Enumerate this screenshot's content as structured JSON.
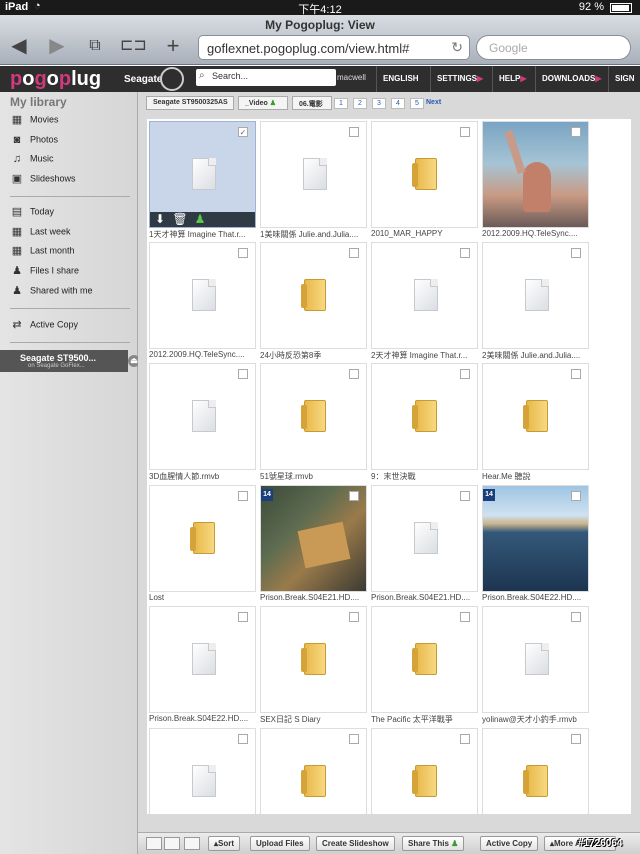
{
  "status": {
    "device": "iPad",
    "time": "下午4:12",
    "battery": "92 %"
  },
  "browser": {
    "title": "My Pogoplug: View",
    "url": "goflexnet.pogoplug.com/view.html#",
    "search_placeholder": "Google"
  },
  "topbar": {
    "brand": "Seagate",
    "search_placeholder": "Search...",
    "user": "macwell",
    "nav": [
      "ENGLISH",
      "SETTINGS",
      "HELP",
      "DOWNLOADS",
      "SIGN"
    ]
  },
  "sidebar": {
    "heading": "My library",
    "library": [
      "Movies",
      "Photos",
      "Music",
      "Slideshows"
    ],
    "recent": [
      "Today",
      "Last week",
      "Last month",
      "Files I share",
      "Shared with me"
    ],
    "active_copy": "Active Copy",
    "device_name": "Seagate ST9500...",
    "device_sub": "on Seagate GoFlex..."
  },
  "breadcrumb": [
    "Seagate ST9500325AS",
    "_Video",
    "06.電影"
  ],
  "pages": [
    "1",
    "2",
    "3",
    "4",
    "5"
  ],
  "next": "Next",
  "items": [
    {
      "label": "1天才神算 Imagine That.r...",
      "type": "file",
      "selected": true,
      "checked": "✓"
    },
    {
      "label": "1美味關係 Julie.and.Julia....",
      "type": "file"
    },
    {
      "label": "2010_MAR_HAPPY",
      "type": "folder"
    },
    {
      "label": "2012.2009.HQ.TeleSync....",
      "type": "photo-woman"
    },
    {
      "label": "2012.2009.HQ.TeleSync....",
      "type": "file"
    },
    {
      "label": "24小時反恐第8季",
      "type": "folder"
    },
    {
      "label": "2天才神算 Imagine That.r...",
      "type": "file"
    },
    {
      "label": "2美味關係 Julie.and.Julia....",
      "type": "file"
    },
    {
      "label": "3D血腥情人節.rmvb",
      "type": "file"
    },
    {
      "label": "51號星球.rmvb",
      "type": "folder"
    },
    {
      "label": "9：末世決戰",
      "type": "folder"
    },
    {
      "label": "Hear.Me 聽說",
      "type": "folder"
    },
    {
      "label": "Lost",
      "type": "folder"
    },
    {
      "label": "Prison.Break.S04E21.HD....",
      "type": "photo-hands",
      "badge": "14"
    },
    {
      "label": "Prison.Break.S04E21.HD....",
      "type": "file"
    },
    {
      "label": "Prison.Break.S04E22.HD....",
      "type": "photo-city",
      "badge": "14"
    },
    {
      "label": "Prison.Break.S04E22.HD....",
      "type": "file"
    },
    {
      "label": "SEX日記 S Diary",
      "type": "folder"
    },
    {
      "label": "The Pacific 太平洋戰爭",
      "type": "folder"
    },
    {
      "label": "yolinaw@天才小釣手.rmvb",
      "type": "file"
    },
    {
      "label": "",
      "type": "file"
    },
    {
      "label": "",
      "type": "folder"
    },
    {
      "label": "",
      "type": "folder"
    },
    {
      "label": "",
      "type": "folder"
    }
  ],
  "toolbar": {
    "sort": "Sort",
    "upload": "Upload Files",
    "slideshow": "Create Slideshow",
    "share": "Share This",
    "active_copy": "Active Copy",
    "more": "More Actions"
  },
  "watermark": "#1726064",
  "colors": {
    "brand_pink": "#d03a7a",
    "selected_tile": "#c9d6ea",
    "link_blue": "#2a5bb0"
  }
}
